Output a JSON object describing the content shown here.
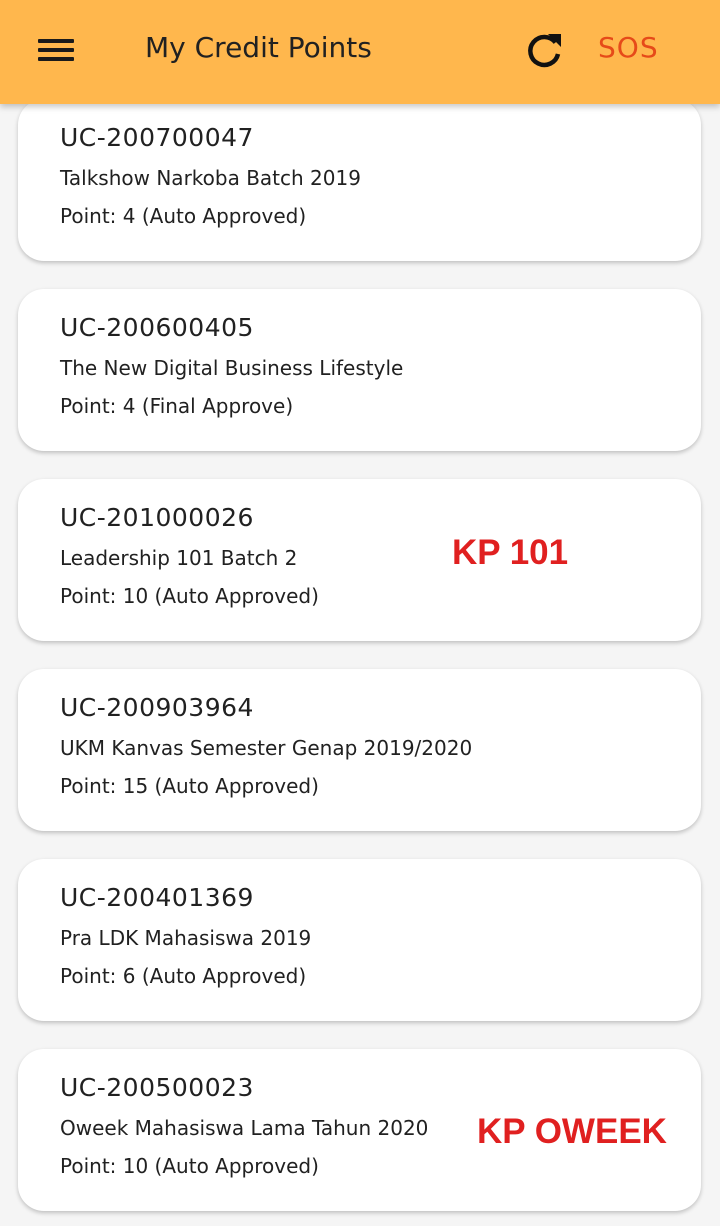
{
  "appbar": {
    "title": "My Credit Points",
    "menu_icon": "hamburger-menu-icon",
    "refresh_icon": "refresh-icon",
    "sos_label": "SOS",
    "background": "#FFB74D",
    "sos_color": "#E64A19"
  },
  "credits": [
    {
      "code": "UC-200700047",
      "name": "Talkshow Narkoba Batch 2019",
      "point": "Point: 4 (Auto Approved)"
    },
    {
      "code": "UC-200600405",
      "name": "The New Digital Business Lifestyle",
      "point": "Point: 4 (Final Approve)"
    },
    {
      "code": "UC-201000026",
      "name": "Leadership 101 Batch 2",
      "point": "Point: 10 (Auto Approved)"
    },
    {
      "code": "UC-200903964",
      "name": "UKM Kanvas Semester Genap 2019/2020",
      "point": "Point: 15 (Auto Approved)"
    },
    {
      "code": "UC-200401369",
      "name": "Pra LDK Mahasiswa 2019",
      "point": "Point: 6 (Auto Approved)"
    },
    {
      "code": "UC-200500023",
      "name": "Oweek Mahasiswa Lama Tahun 2020",
      "point": "Point: 10 (Auto Approved)"
    }
  ],
  "annotations": {
    "kp_101": "KP 101",
    "kp_oweek": "KP OWEEK",
    "color": "#E02020"
  }
}
